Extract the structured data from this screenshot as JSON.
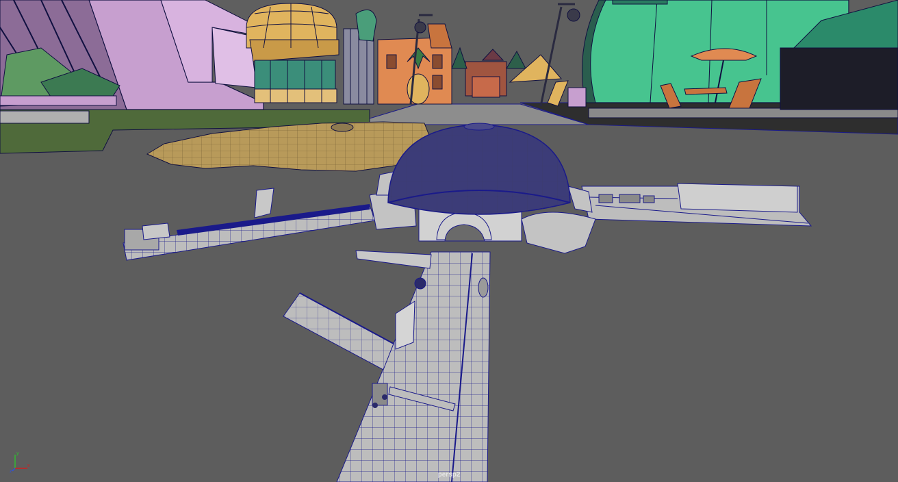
{
  "viewport": {
    "camera_name": "persp2"
  },
  "axis_gizmo": {
    "x_color": "#d02020",
    "y_color": "#30c030",
    "z_color": "#3050e0"
  },
  "colors": {
    "background": "#5d5d5d",
    "wireframe": "#1a1a8a",
    "dome": "#3c3c78",
    "structure": "#bdbdbd",
    "sand": "#b89a5a",
    "pink_building": "#c79fcf",
    "green_building": "#47c48f",
    "yellow_dome": "#e0b45e",
    "orange_building": "#e08a52"
  }
}
